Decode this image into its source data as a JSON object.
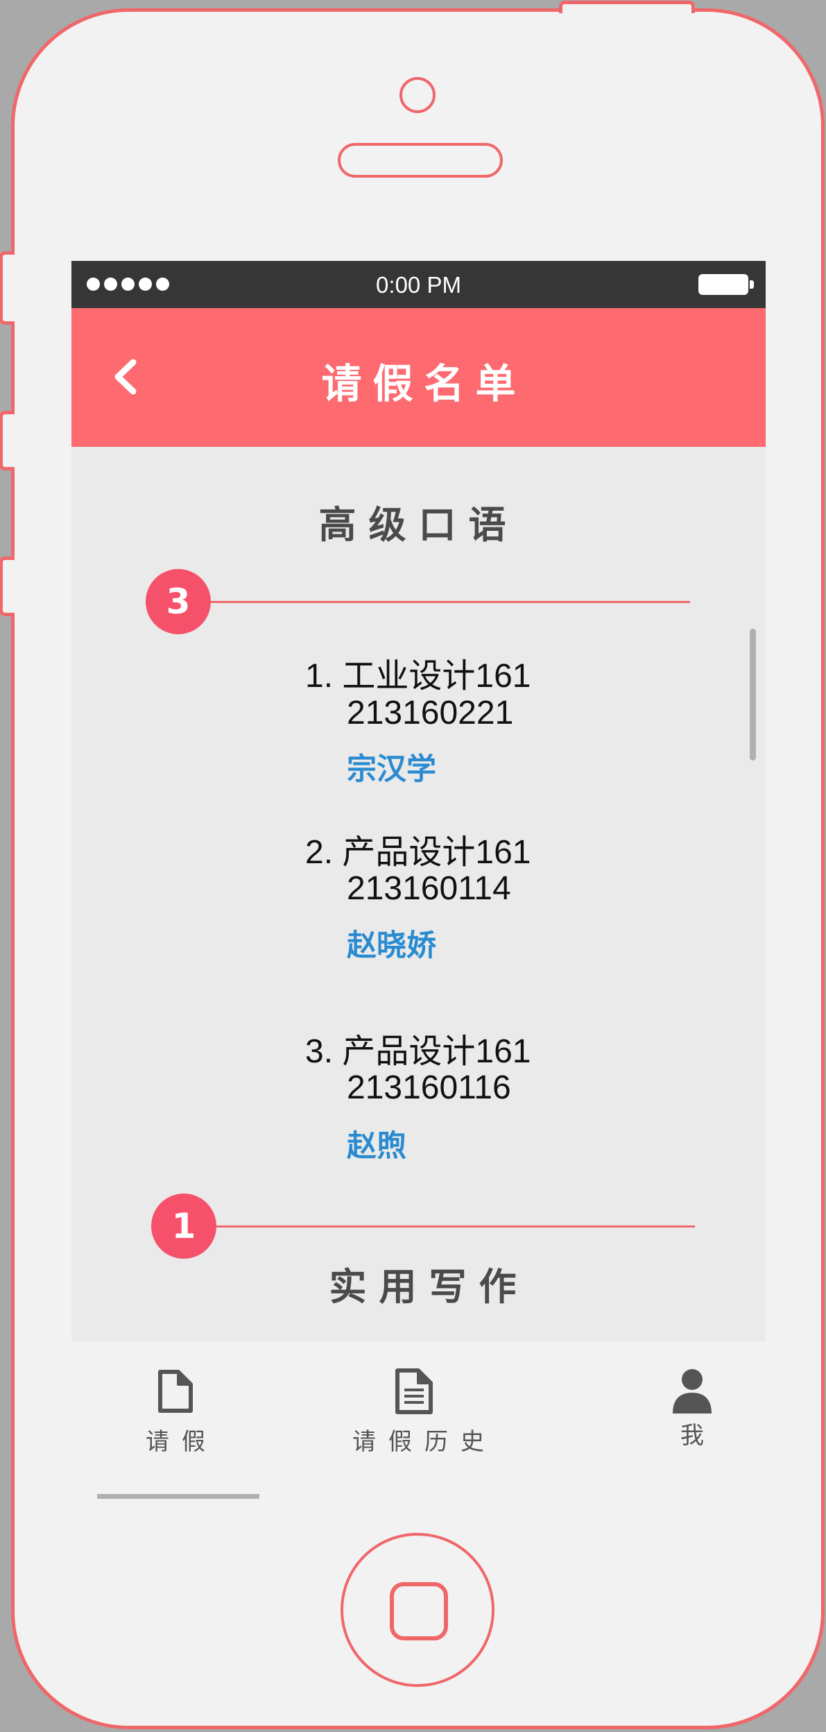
{
  "status_bar": {
    "time": "0:00 PM",
    "signal_icon": "signal-dots-icon",
    "battery_icon": "battery-icon"
  },
  "nav": {
    "title": "请假名单",
    "back_icon": "chevron-left-icon"
  },
  "sections": [
    {
      "title": "高级口语",
      "count": "3",
      "entries": [
        {
          "number": "1.",
          "class_name": "工业设计161",
          "student_id": "213160221",
          "name": "宗汉学"
        },
        {
          "number": "2.",
          "class_name": "产品设计161",
          "student_id": "213160114",
          "name": "赵晓娇"
        },
        {
          "number": "3.",
          "class_name": "产品设计161",
          "student_id": "213160116",
          "name": "赵煦"
        }
      ]
    },
    {
      "title": "实用写作",
      "count": "1"
    }
  ],
  "tab_bar": {
    "items": [
      {
        "label": "请假",
        "icon": "document-icon"
      },
      {
        "label": "请假历史",
        "icon": "document-lines-icon"
      },
      {
        "label": "我",
        "icon": "user-icon"
      }
    ],
    "active_index": 0
  },
  "colors": {
    "accent": "#fd6a70",
    "badge": "#f5516a",
    "name_link": "#2a8bd0",
    "status_bar": "#363636"
  }
}
